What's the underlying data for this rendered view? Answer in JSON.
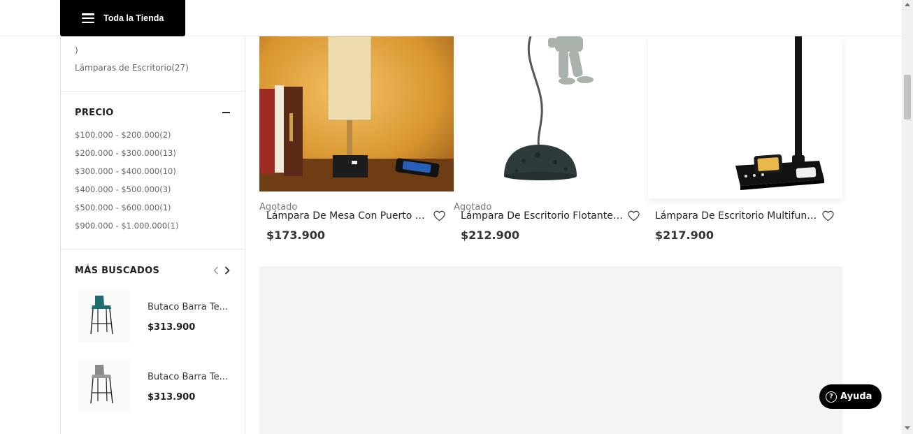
{
  "header": {
    "store_button_label": "Toda la Tienda"
  },
  "sidebar": {
    "category_tail": ")",
    "category_item": "Lámparas de Escritorio(27)",
    "price_section": {
      "title": "PRECIO",
      "items": [
        "$100.000 - $200.000(2)",
        "$200.000 - $300.000(13)",
        "$300.000 - $400.000(10)",
        "$400.000 - $500.000(3)",
        "$500.000 - $600.000(1)",
        "$900.000 - $1.000.000(1)"
      ]
    },
    "most_searched": {
      "title": "MÁS BUSCADOS",
      "items": [
        {
          "name": "Butaco Barra Te...",
          "price": "$313.900",
          "icon": "teal-bar-stool"
        },
        {
          "name": "Butaco Barra Te...",
          "price": "$313.900",
          "icon": "gray-bar-stool"
        }
      ]
    }
  },
  "products": [
    {
      "status": "Agotado",
      "name": "Lámpara De Mesa Con Puerto US...",
      "price": "$173.900",
      "image": "table-lamp-usb"
    },
    {
      "status": "Agotado",
      "name": "Lámpara De Escritorio Flotante A...",
      "price": "$212.900",
      "image": "astronaut-lamp"
    },
    {
      "status": "",
      "name": "Lámpara De Escritorio Multifunci...",
      "price": "$217.900",
      "image": "wireless-charging-desk-lamp"
    }
  ],
  "help": {
    "label": "Ayuda",
    "icon_glyph": "?"
  },
  "colors": {
    "header_button_bg": "#000000",
    "banner_bg": "#f4f4f4",
    "text_primary": "#222222",
    "text_muted": "#666666"
  }
}
